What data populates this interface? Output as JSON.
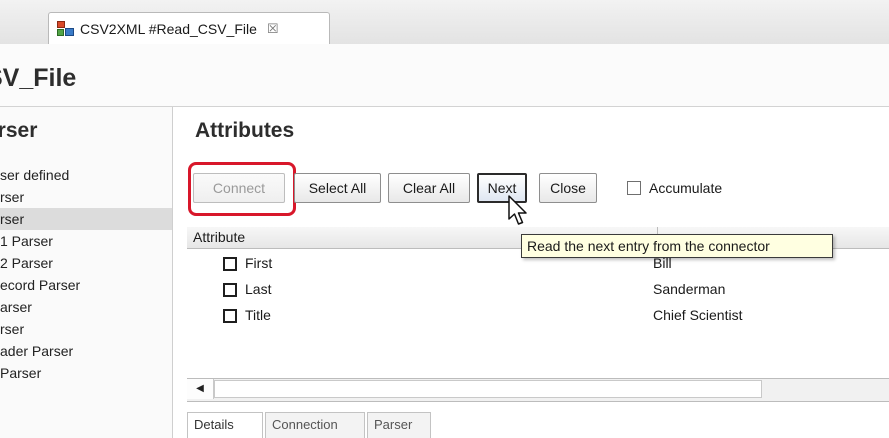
{
  "tab": {
    "label": "CSV2XML #Read_CSV_File",
    "close_glyph": "☒"
  },
  "page": {
    "title": "SV_File"
  },
  "left_panel": {
    "header": "arser",
    "items": [
      {
        "label": "ser defined",
        "selected": false
      },
      {
        "label": "rser",
        "selected": false
      },
      {
        "label": "rser",
        "selected": true
      },
      {
        "label": "1 Parser",
        "selected": false
      },
      {
        "label": "2 Parser",
        "selected": false
      },
      {
        "label": "ecord Parser",
        "selected": false
      },
      {
        "label": "arser",
        "selected": false
      },
      {
        "label": "rser",
        "selected": false
      },
      {
        "label": "ader Parser",
        "selected": false
      },
      {
        "label": "Parser",
        "selected": false
      }
    ]
  },
  "attributes": {
    "title": "Attributes",
    "toolbar": {
      "connect": "Connect",
      "select_all": "Select All",
      "clear_all": "Clear All",
      "next": "Next",
      "close": "Close",
      "accumulate": "Accumulate"
    },
    "column_header": "Attribute",
    "rows": [
      {
        "name": "First",
        "value": "Bill"
      },
      {
        "name": "Last",
        "value": "Sanderman"
      },
      {
        "name": "Title",
        "value": "Chief Scientist"
      }
    ],
    "scroll_left_glyph": "◀",
    "bottom_tabs": [
      "Details",
      "Connection",
      "Parser"
    ]
  },
  "tooltip": "Read the next entry from the connector",
  "colors": {
    "highlight_ring": "#d8172a",
    "tooltip_bg": "#ffffe1",
    "selected_row": "#dcdcdc"
  }
}
